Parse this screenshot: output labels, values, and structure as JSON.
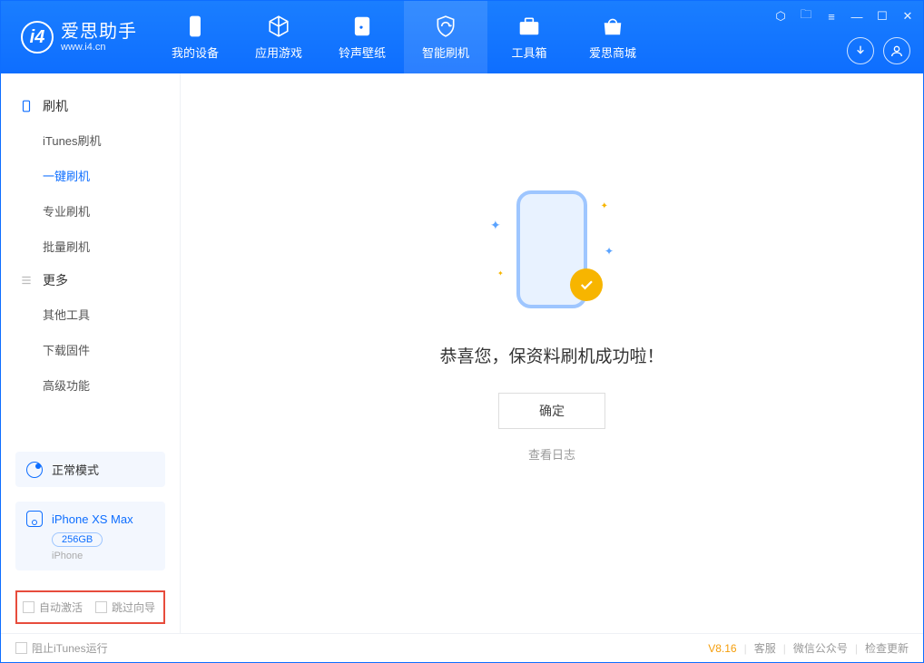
{
  "app": {
    "title": "爱思助手",
    "subtitle": "www.i4.cn"
  },
  "nav": {
    "items": [
      {
        "label": "我的设备"
      },
      {
        "label": "应用游戏"
      },
      {
        "label": "铃声壁纸"
      },
      {
        "label": "智能刷机"
      },
      {
        "label": "工具箱"
      },
      {
        "label": "爱思商城"
      }
    ]
  },
  "sidebar": {
    "group1": {
      "title": "刷机",
      "items": [
        {
          "label": "iTunes刷机"
        },
        {
          "label": "一键刷机"
        },
        {
          "label": "专业刷机"
        },
        {
          "label": "批量刷机"
        }
      ]
    },
    "group2": {
      "title": "更多",
      "items": [
        {
          "label": "其他工具"
        },
        {
          "label": "下载固件"
        },
        {
          "label": "高级功能"
        }
      ]
    },
    "mode": {
      "label": "正常模式"
    },
    "device": {
      "name": "iPhone XS Max",
      "capacity": "256GB",
      "type": "iPhone"
    },
    "options": {
      "auto_activate": "自动激活",
      "skip_guide": "跳过向导"
    }
  },
  "main": {
    "success_message": "恭喜您，保资料刷机成功啦！",
    "ok_button": "确定",
    "view_log": "查看日志"
  },
  "footer": {
    "block_itunes": "阻止iTunes运行",
    "version": "V8.16",
    "support": "客服",
    "wechat": "微信公众号",
    "check_update": "检查更新"
  }
}
